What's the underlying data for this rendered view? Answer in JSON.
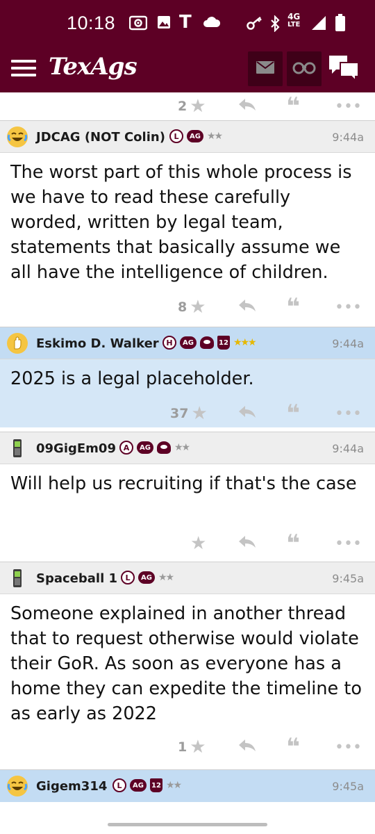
{
  "status_bar": {
    "time": "10:18",
    "icons": [
      "screen-record-icon",
      "image-icon",
      "t-mobile-icon",
      "cloud-icon",
      "key-icon",
      "bluetooth-icon",
      "signal-icon",
      "battery-icon"
    ],
    "network": "4G",
    "network_sub": "LTE"
  },
  "app_bar": {
    "logo": "TexAgs",
    "menu_icon": "hamburger-menu-icon",
    "actions": [
      "mail-icon",
      "binoculars-icon",
      "chat-bubbles-icon"
    ]
  },
  "colors": {
    "brand_maroon": "#5d0025",
    "highlight_bg": "#d5e7f7",
    "header_bg": "#eeeeee",
    "star_gold": "#e6b800"
  },
  "prev_post_actions": {
    "star_count": "2"
  },
  "posts": [
    {
      "username": "JDCAG (NOT Colin)",
      "badges": [
        "L",
        "AG"
      ],
      "stars": "★★",
      "time": "9:44a",
      "body": "The worst part of this whole process is we have to read these carefully worded, written by legal team, statements that basically assume we all have the intelligence of children.",
      "star_count": "8",
      "highlighted": false
    },
    {
      "username": "Eskimo D. Walker",
      "badges": [
        "H",
        "AG",
        "helmet",
        "12"
      ],
      "stars": "★★★",
      "time": "9:44a",
      "body": "2025 is a legal placeholder.",
      "star_count": "37",
      "highlighted": true
    },
    {
      "username": "09GigEm09",
      "badges": [
        "A",
        "AG",
        "helmet"
      ],
      "stars": "★★",
      "time": "9:44a",
      "body": "Will help us recruiting if that's the case",
      "star_count": "",
      "highlighted": false
    },
    {
      "username": "Spaceball 1",
      "badges": [
        "L",
        "AG"
      ],
      "stars": "★★",
      "time": "9:45a",
      "body": "Someone explained in another thread that to request otherwise would violate their GoR. As soon as everyone has a home they can expedite the timeline to as early as 2022",
      "star_count": "1",
      "highlighted": false
    },
    {
      "username": "Gigem314",
      "badges": [
        "L",
        "AG",
        "12"
      ],
      "stars": "★★",
      "time": "9:45a",
      "highlighted": true
    }
  ]
}
